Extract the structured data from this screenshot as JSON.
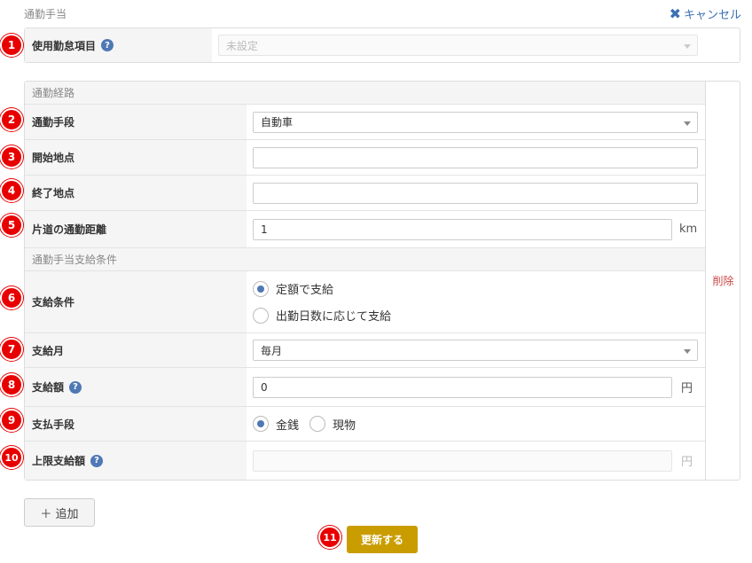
{
  "page": {
    "section_title": "通勤手当",
    "cancel_label": "キャンセル"
  },
  "fields": {
    "attendance_item": {
      "label": "使用勤怠項目",
      "value": "未設定"
    },
    "route_header": "通勤経路",
    "transport": {
      "label": "通勤手段",
      "value": "自動車"
    },
    "start_point": {
      "label": "開始地点",
      "value": ""
    },
    "end_point": {
      "label": "終了地点",
      "value": ""
    },
    "distance": {
      "label": "片道の通勤距離",
      "value": "1",
      "unit": "km"
    },
    "condition_header": "通勤手当支給条件",
    "pay_condition": {
      "label": "支給条件",
      "options": [
        {
          "label": "定額で支給",
          "checked": true
        },
        {
          "label": "出勤日数に応じて支給",
          "checked": false
        }
      ]
    },
    "pay_month": {
      "label": "支給月",
      "value": "毎月"
    },
    "pay_amount": {
      "label": "支給額",
      "value": "0",
      "unit": "円"
    },
    "pay_method": {
      "label": "支払手段",
      "options": [
        {
          "label": "金銭",
          "checked": true
        },
        {
          "label": "現物",
          "checked": false
        }
      ]
    },
    "max_amount": {
      "label": "上限支給額",
      "value": "",
      "unit": "円"
    }
  },
  "delete_label": "削除",
  "add_label": "＋ 追加",
  "update_label": "更新する",
  "badges": [
    "1",
    "2",
    "3",
    "4",
    "5",
    "6",
    "7",
    "8",
    "9",
    "10",
    "11"
  ],
  "colors": {
    "badge": "#e80000",
    "accent": "#4f78b5",
    "update_button": "#c99d00",
    "delete": "#cc4444"
  }
}
